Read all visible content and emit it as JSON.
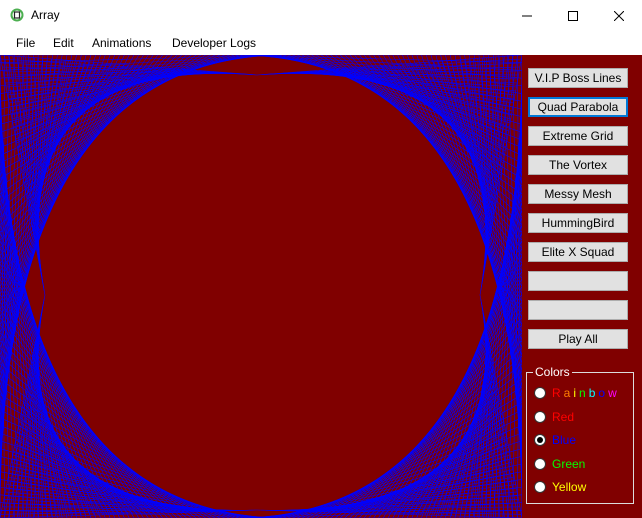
{
  "window": {
    "title": "Array",
    "minimize_icon": "minimize-icon",
    "maximize_icon": "maximize-icon",
    "close_icon": "close-icon"
  },
  "menu": [
    "File",
    "Edit",
    "Animations",
    "Developer Logs"
  ],
  "buttons": [
    "V.I.P Boss Lines",
    "Quad Parabola",
    "Extreme Grid",
    "The Vortex",
    "Messy Mesh",
    "HummingBird",
    "Elite X Squad",
    "",
    "",
    "Play All"
  ],
  "active_button": "Quad Parabola",
  "colors_group": {
    "label": "Colors",
    "options": [
      {
        "label": "Rainbow",
        "color": "multi",
        "checked": false
      },
      {
        "label": "Red",
        "color": "#ff0000",
        "checked": false
      },
      {
        "label": "Blue",
        "color": "#0000ff",
        "checked": true
      },
      {
        "label": "Green",
        "color": "#00ff00",
        "checked": false
      },
      {
        "label": "Yellow",
        "color": "#ffff00",
        "checked": false
      }
    ]
  },
  "theme": {
    "background": "#800000",
    "line_color": "#0000ff"
  }
}
